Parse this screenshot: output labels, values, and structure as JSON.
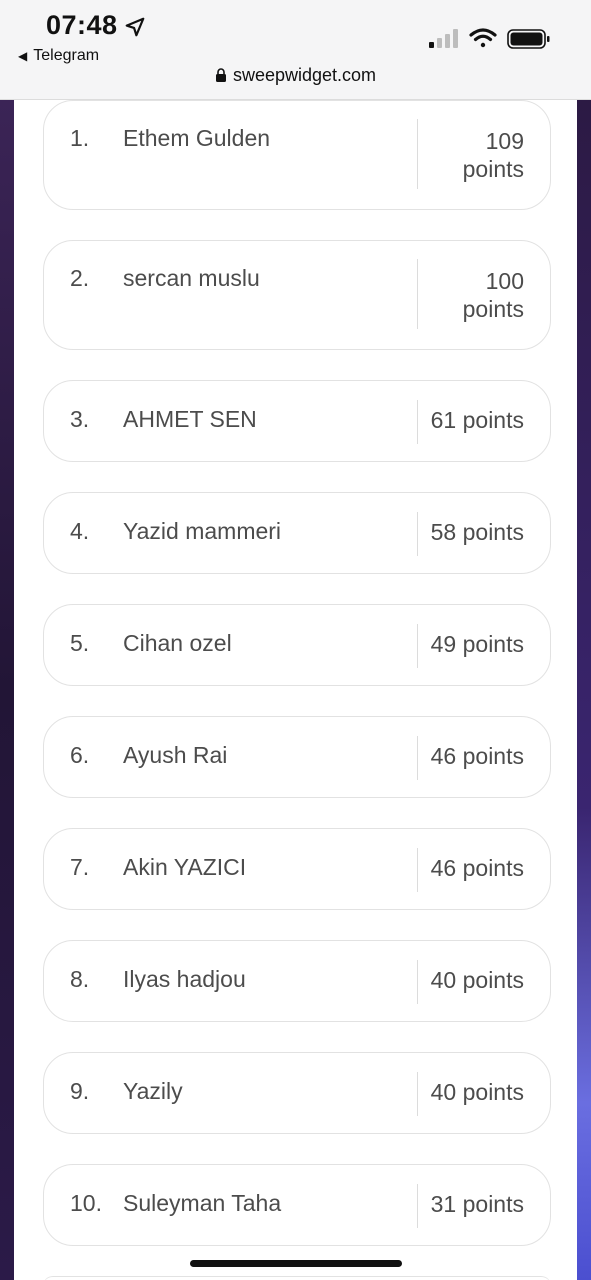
{
  "status_bar": {
    "time": "07:48",
    "back_label": "Telegram",
    "url": "sweepwidget.com"
  },
  "leaderboard": [
    {
      "rank": "1.",
      "name": "Ethem Gulden",
      "points": "109 points"
    },
    {
      "rank": "2.",
      "name": "sercan muslu",
      "points": "100 points"
    },
    {
      "rank": "3.",
      "name": "AHMET SEN",
      "points": "61 points"
    },
    {
      "rank": "4.",
      "name": "Yazid mammeri",
      "points": "58 points"
    },
    {
      "rank": "5.",
      "name": "Cihan ozel",
      "points": "49 points"
    },
    {
      "rank": "6.",
      "name": "Ayush Rai",
      "points": "46 points"
    },
    {
      "rank": "7.",
      "name": "Akin YAZICI",
      "points": "46 points"
    },
    {
      "rank": "8.",
      "name": "Ilyas hadjou",
      "points": "40 points"
    },
    {
      "rank": "9.",
      "name": "Yazily",
      "points": "40 points"
    },
    {
      "rank": "10.",
      "name": "Suleyman Taha",
      "points": "31 points"
    }
  ]
}
